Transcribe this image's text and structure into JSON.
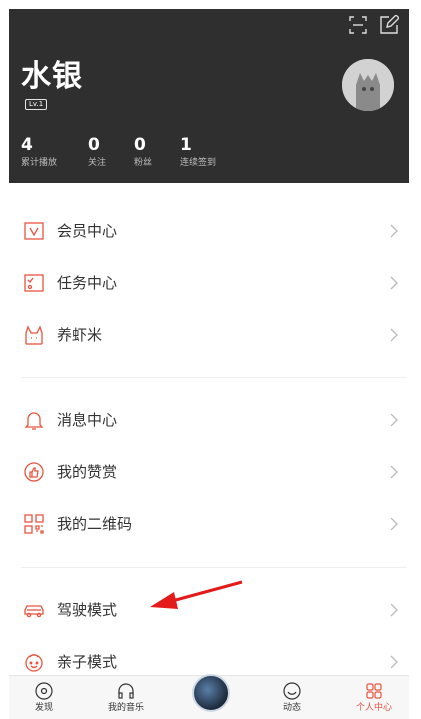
{
  "header": {
    "name": "水银",
    "level": "Lv.1",
    "stats": [
      {
        "value": "4",
        "label": "累计播放"
      },
      {
        "value": "0",
        "label": "关注"
      },
      {
        "value": "0",
        "label": "粉丝"
      },
      {
        "value": "1",
        "label": "连续签到"
      }
    ]
  },
  "menu": {
    "group1": [
      {
        "label": "会员中心",
        "icon": "vip-icon"
      },
      {
        "label": "任务中心",
        "icon": "task-icon"
      },
      {
        "label": "养虾米",
        "icon": "shrimp-icon"
      }
    ],
    "group2": [
      {
        "label": "消息中心",
        "icon": "bell-icon"
      },
      {
        "label": "我的赞赏",
        "icon": "thumb-icon"
      },
      {
        "label": "我的二维码",
        "icon": "qrcode-icon"
      }
    ],
    "group3": [
      {
        "label": "驾驶模式",
        "icon": "car-icon"
      },
      {
        "label": "亲子模式",
        "icon": "child-icon"
      }
    ]
  },
  "nav": [
    {
      "label": "发现",
      "icon": "disc-icon"
    },
    {
      "label": "我的音乐",
      "icon": "headphones-icon"
    },
    {
      "label": "动态",
      "icon": "smile-icon"
    },
    {
      "label": "个人中心",
      "icon": "grid-icon"
    }
  ],
  "colors": {
    "accent": "#e8543f",
    "header_bg": "#2f2f2f"
  }
}
